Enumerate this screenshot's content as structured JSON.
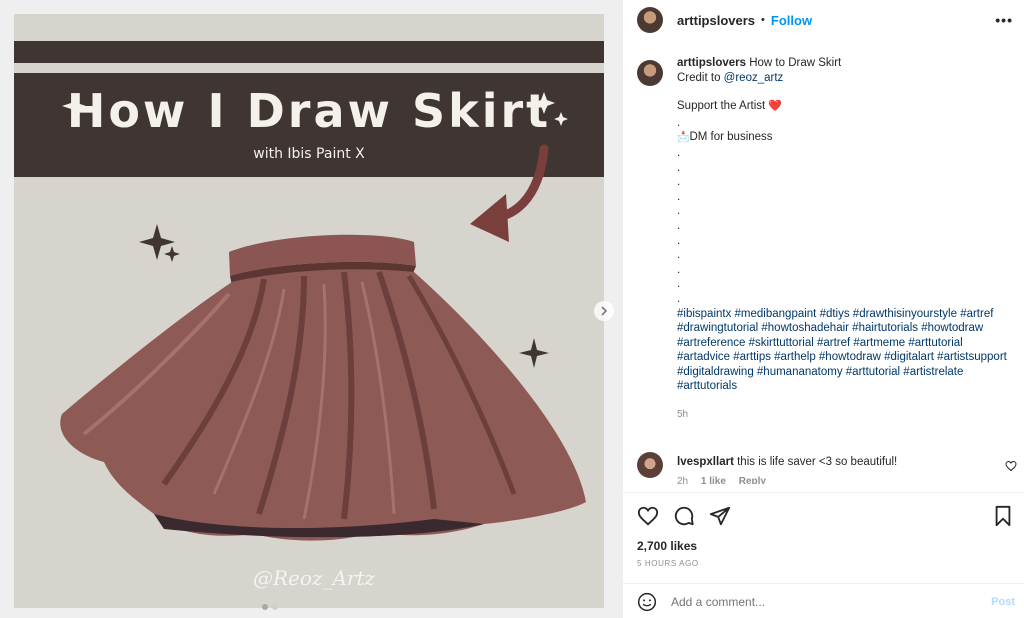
{
  "media": {
    "title": "How I Draw Skirt",
    "subtitle": "with Ibis Paint X",
    "watermark": "@Reoz_Artz",
    "colors": {
      "band": "#3f3532",
      "background": "#d7d3cd",
      "skirt": "#8e5a55"
    }
  },
  "header": {
    "username": "arttipslovers",
    "separator": "•",
    "follow_label": "Follow",
    "more_label": "•••"
  },
  "caption": {
    "username": "arttipslovers",
    "title": "How to Draw Skirt",
    "credit_prefix": "Credit to",
    "credit_mention": "@reoz_artz",
    "support": "Support the Artist",
    "heart": "❤️",
    "dm_icon": "📩",
    "dm": "DM for business",
    "dots": ".\n.\n.\n.\n.\n.\n.\n.\n.\n.\n.",
    "hashtags": "#ibispaintx #medibangpaint #dtiys #drawthisinyourstyle #artref #drawingtutorial #howtoshadehair #hairtutorials #howtodraw #artreference #skirttuttorial #artref #artmeme #arttutorial #artadvice #arttips #arthelp #howtodraw #digitalart #artistsupport #digitaldrawing #humananatomy #arttutorial #artistrelate #arttutorials",
    "time": "5h"
  },
  "comment": {
    "username": "lvespxllart",
    "text": "this is life saver <3 so beautiful!",
    "time": "2h",
    "likes": "1 like",
    "reply": "Reply"
  },
  "actions": {
    "likes": "2,700 likes",
    "posted": "5 HOURS AGO",
    "comment_placeholder": "Add a comment...",
    "post_label": "Post"
  }
}
